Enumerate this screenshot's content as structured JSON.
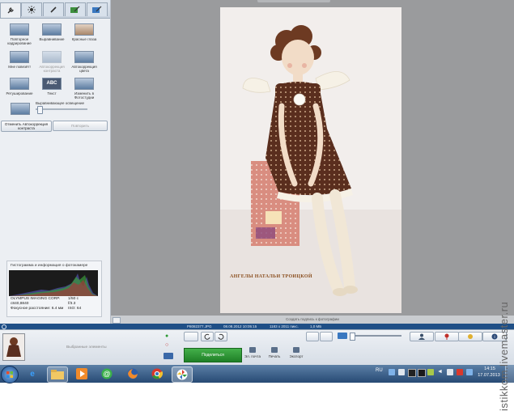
{
  "tools": [
    {
      "label": "Повторное кадрирование",
      "dim": false
    },
    {
      "label": "Выравнивание",
      "dim": false
    },
    {
      "label": "Красные глаза",
      "dim": false
    },
    {
      "label": "Мне повезёт!",
      "dim": false
    },
    {
      "label": "Автокоррекция контраста",
      "dim": true
    },
    {
      "label": "Автокоррекция цвета",
      "dim": false
    },
    {
      "label": "Ретуширование",
      "dim": false
    },
    {
      "label": "Текст",
      "dim": false
    },
    {
      "label": "Изменить в Фотостудии",
      "dim": false
    }
  ],
  "text_icon_label": "ABC",
  "fill_light_label": "Выравнивающее освещение",
  "undo_button": "Отменить Автокоррекция контраста",
  "redo_button": "Повторить",
  "histogram": {
    "title": "Гистограмма и информация о фотокамере",
    "camera": "OLYMPUS IMAGING CORP.",
    "model": "c840,8840",
    "focal": "Фокусное расстояние: 6.4 мм",
    "exposure": "1/50 с",
    "aperture": "f/3.3",
    "iso": "ISO: 64"
  },
  "photo": {
    "signature": "АНГЕЛЫ НАТАЛЬИ ТРОИЦКОЙ"
  },
  "caption_placeholder": "Создать подпись к фотографии",
  "infobar": {
    "filename": "P8082377.JPG",
    "datetime": "08.08.2012 10:05:15",
    "dims": "1183 x 2011 пикс.",
    "size": "1,0 МБ"
  },
  "tray": {
    "selected_label": "Выбранные элементы",
    "share_label": "Поделиться",
    "actions": [
      "Эл. почта",
      "Печать",
      "Экспорт"
    ]
  },
  "taskbar": {
    "lang": "RU",
    "time": "14:15",
    "date": "17.07.2013"
  },
  "watermark": "istikkom.livemaster.ru",
  "colors": {
    "accent_green": "#2e9a36",
    "info_bar": "#1f4f86",
    "taskbar": "#3a608a"
  }
}
